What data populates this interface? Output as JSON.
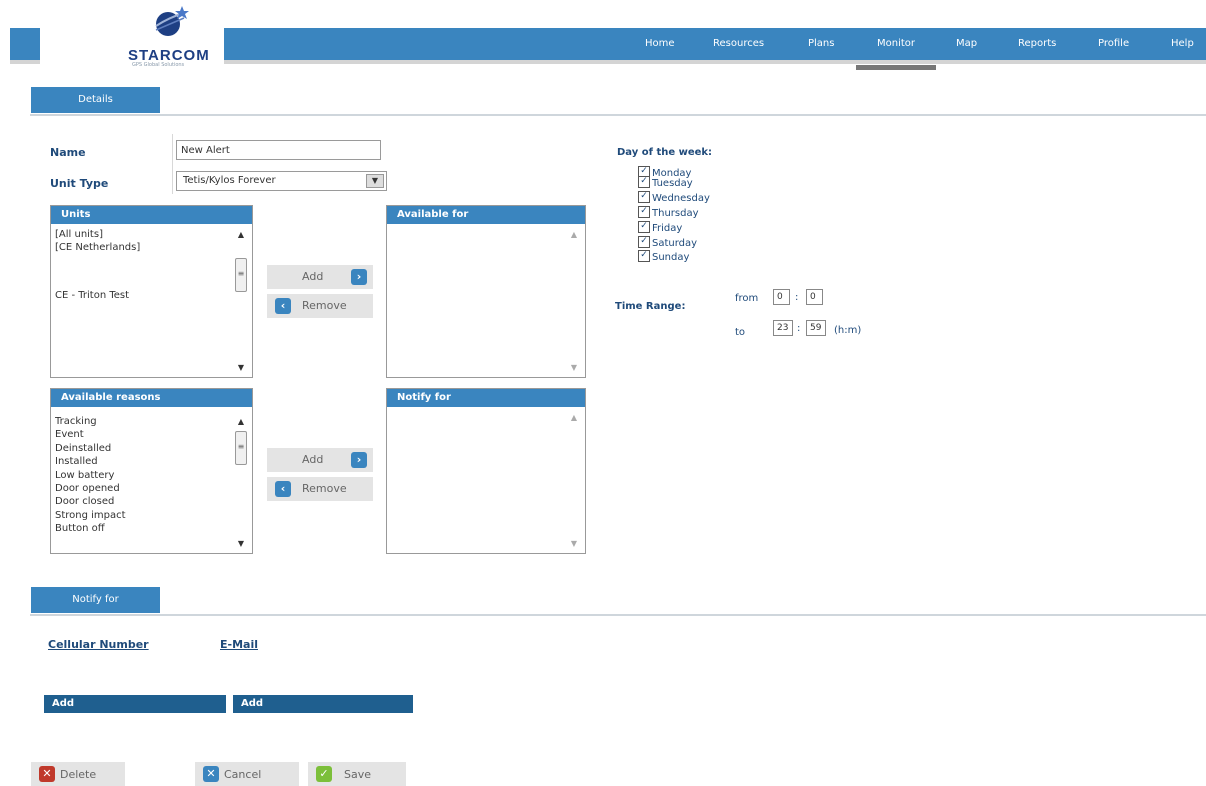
{
  "brand": {
    "name": "STARCOM",
    "tagline": "GPS Global Solutions"
  },
  "nav": [
    "Home",
    "Resources",
    "Plans",
    "Monitor",
    "Map",
    "Reports",
    "Profile",
    "Help"
  ],
  "details_tab": "Details",
  "form": {
    "name_label": "Name",
    "name_value": "New Alert",
    "unit_type_label": "Unit Type",
    "unit_type_value": "Tetis/Kylos Forever"
  },
  "units": {
    "title": "Units",
    "items": [
      "[All units]",
      "[CE Netherlands]",
      "",
      "",
      "CE - Triton Test"
    ]
  },
  "available_for": {
    "title": "Available for",
    "items": []
  },
  "reasons": {
    "title": "Available reasons",
    "items": [
      "Tracking",
      "Event",
      "Deinstalled",
      "Installed",
      "Low battery",
      "Door opened",
      "Door closed",
      "Strong impact",
      "Button off"
    ]
  },
  "notify_for_list": {
    "title": "Notify for",
    "items": []
  },
  "buttons": {
    "add": "Add",
    "remove": "Remove",
    "delete": "Delete",
    "cancel": "Cancel",
    "save": "Save"
  },
  "days": {
    "title": "Day of the week:",
    "items": [
      "Monday",
      "Tuesday",
      "Wednesday",
      "Thursday",
      "Friday",
      "Saturday",
      "Sunday"
    ],
    "checked": [
      true,
      true,
      true,
      true,
      true,
      true,
      true
    ]
  },
  "time_range": {
    "label": "Time Range:",
    "from_label": "from",
    "from_h": "0",
    "from_m": "0",
    "to_label": "to",
    "to_h": "23",
    "to_m": "59",
    "separator": ":",
    "unit": "(h:m)"
  },
  "notify_section": {
    "tab": "Notify for",
    "cellular_label": "Cellular Number",
    "email_label": "E-Mail",
    "add_label": "Add"
  },
  "icons": {
    "check": "✓",
    "arrow_right": "›",
    "arrow_left": "‹",
    "scroll_up": "▲",
    "scroll_down": "▼",
    "dropdown": "▼",
    "delete": "✕",
    "cancel": "✕",
    "save": "✓"
  },
  "colors": {
    "accent": "#3a85bf",
    "dark_accent": "#1f5f8f",
    "label": "#1f4a7a",
    "delete_red": "#c0392b",
    "save_green": "#7cbf3a"
  }
}
